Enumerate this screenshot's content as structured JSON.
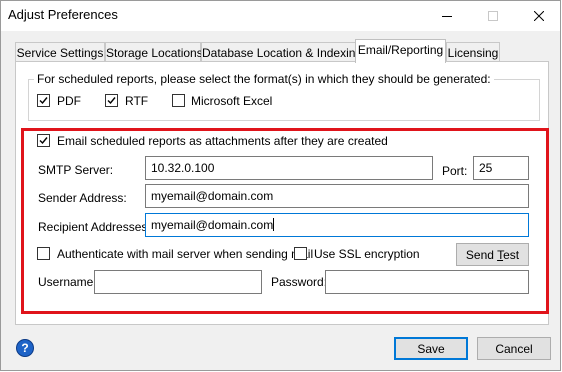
{
  "window": {
    "title": "Adjust Preferences"
  },
  "tabs": [
    {
      "label": "Service Settings",
      "active": false
    },
    {
      "label": "Storage Locations",
      "active": false
    },
    {
      "label": "Database Location & Indexing",
      "active": false
    },
    {
      "label": "Email/Reporting",
      "active": true
    },
    {
      "label": "Licensing",
      "active": false
    }
  ],
  "formats": {
    "legend": "For scheduled reports, please select the format(s) in which they should be generated:",
    "options": [
      {
        "label": "PDF",
        "checked": true
      },
      {
        "label": "RTF",
        "checked": true
      },
      {
        "label": "Microsoft Excel",
        "checked": false
      }
    ]
  },
  "email": {
    "attach_label": "Email scheduled reports as attachments after they are created",
    "attach_checked": true,
    "smtp_label": "SMTP Server:",
    "smtp_value": "10.32.0.100",
    "port_label": "Port:",
    "port_value": "25",
    "sender_label": "Sender Address:",
    "sender_value": "myemail@domain.com",
    "recipient_label": "Recipient Addresses:",
    "recipient_value": "myemail@domain.com",
    "auth_label": "Authenticate with mail server when sending mail",
    "auth_checked": false,
    "ssl_label": "Use SSL encryption",
    "ssl_checked": false,
    "send_test_label": "Send Test",
    "username_label": "Username:",
    "username_value": "",
    "password_label": "Password:",
    "password_value": ""
  },
  "footer": {
    "help_icon": "?",
    "save_label": "Save",
    "cancel_label": "Cancel"
  },
  "colors": {
    "highlight_border": "#e0141b",
    "focus_border": "#0078d7",
    "help_icon_bg": "#1e63c7"
  }
}
